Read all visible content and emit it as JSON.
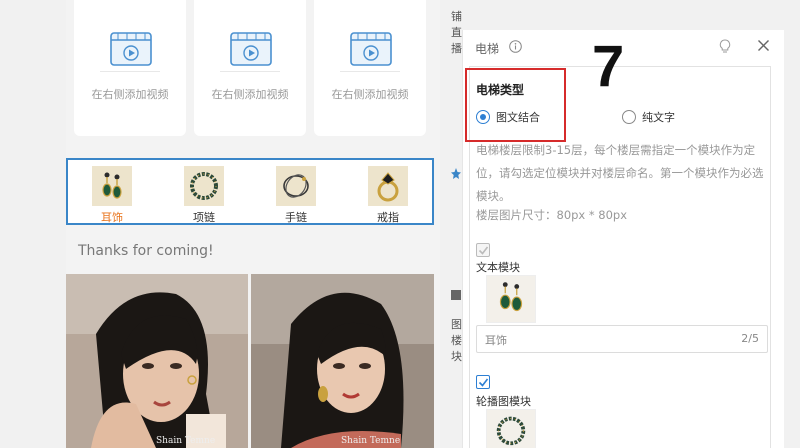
{
  "preview": {
    "video_placeholders": [
      {
        "text": "在右侧添加视频"
      },
      {
        "text": "在右侧添加视频"
      },
      {
        "text": "在右侧添加视频"
      }
    ],
    "elevator_nav": [
      {
        "label": "耳饰",
        "active": true
      },
      {
        "label": "项链",
        "active": false
      },
      {
        "label": "手链",
        "active": false
      },
      {
        "label": "戒指",
        "active": false
      }
    ],
    "thanks_text": "Thanks for coming!",
    "photos": [
      {
        "watermark": "Shain Temne"
      },
      {
        "watermark": "Shain Temne"
      }
    ]
  },
  "strip": {
    "chars": [
      "铺",
      "直",
      "播",
      "图",
      "楼",
      "块"
    ]
  },
  "panel": {
    "title": "电梯",
    "elevator_type_title": "电梯类型",
    "options": [
      {
        "label": "图文结合",
        "selected": true
      },
      {
        "label": "纯文字",
        "selected": false
      }
    ],
    "description": "电梯楼层限制3-15层，每个楼层需指定一个模块作为定位，请勾选定位模块并对楼层命名。第一个模块作为必选模块。",
    "image_size": "楼层图片尺寸：80px * 80px",
    "modules": [
      {
        "label": "文本模块",
        "checked": true,
        "disabled": true,
        "name_value": "耳饰",
        "name_count": "2/5"
      },
      {
        "label": "轮播图模块",
        "checked": true,
        "disabled": false
      }
    ]
  },
  "annotation": {
    "step_number": "7"
  },
  "colors": {
    "accent": "#2d7fd3",
    "highlight_box": "#d62b2b",
    "nav_border": "#3a86c8",
    "active_tab": "#e8741d"
  }
}
